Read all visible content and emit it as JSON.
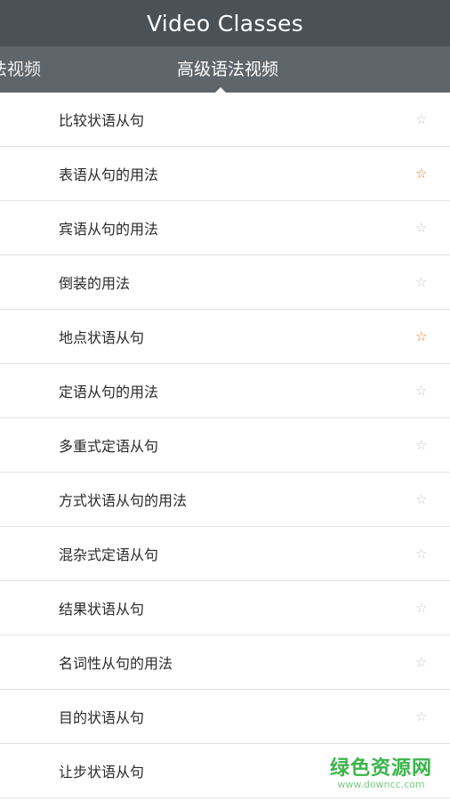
{
  "header": {
    "title": "Video Classes"
  },
  "tabs": [
    {
      "label": "法视频",
      "active": false
    },
    {
      "label": "高级语法视频",
      "active": true
    }
  ],
  "items": [
    {
      "label": "比较状语从句",
      "favorited": false
    },
    {
      "label": "表语从句的用法",
      "favorited": true
    },
    {
      "label": "宾语从句的用法",
      "favorited": false
    },
    {
      "label": "倒装的用法",
      "favorited": false
    },
    {
      "label": "地点状语从句",
      "favorited": true
    },
    {
      "label": "定语从句的用法",
      "favorited": false
    },
    {
      "label": "多重式定语从句",
      "favorited": false
    },
    {
      "label": "方式状语从句的用法",
      "favorited": false
    },
    {
      "label": "混杂式定语从句",
      "favorited": false
    },
    {
      "label": "结果状语从句",
      "favorited": false
    },
    {
      "label": "名词性从句的用法",
      "favorited": false
    },
    {
      "label": "目的状语从句",
      "favorited": false
    },
    {
      "label": "让步状语从句",
      "favorited": false
    }
  ],
  "icons": {
    "favorite": "star-outline-icon"
  },
  "colors": {
    "header_bg": "#4a5157",
    "tab_bg": "#5e656b",
    "star_active": "#e8782b",
    "star_inactive": "#c9c9c9"
  },
  "watermark": {
    "title": "绿色资源网",
    "url": "www.downcc.com"
  }
}
